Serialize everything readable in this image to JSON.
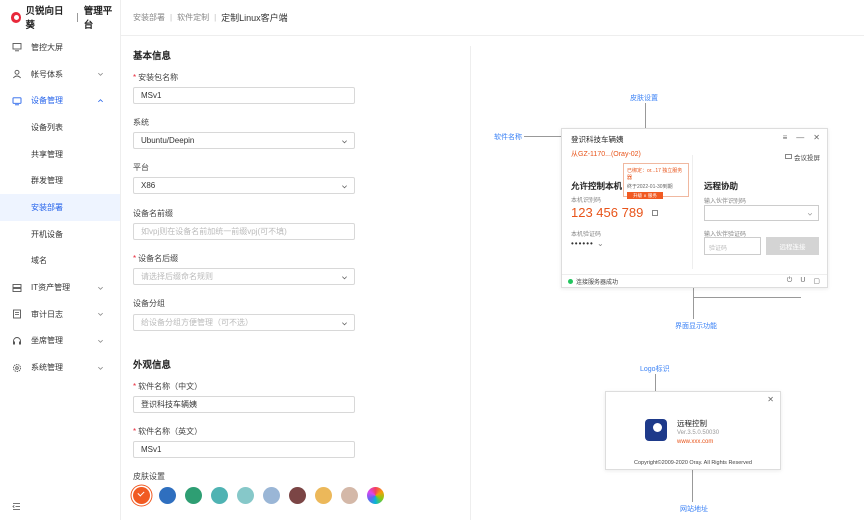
{
  "brand": {
    "name": "贝锐向日葵",
    "platform": "管理平台"
  },
  "sidebar": {
    "items": [
      {
        "label": "管控大屏",
        "icon": "monitor-icon",
        "has_children": false
      },
      {
        "label": "帐号体系",
        "icon": "user-icon",
        "has_children": true
      },
      {
        "label": "设备管理",
        "icon": "device-icon",
        "has_children": true,
        "expanded": true,
        "children": [
          {
            "label": "设备列表"
          },
          {
            "label": "共享管理"
          },
          {
            "label": "群发管理"
          },
          {
            "label": "安装部署",
            "active": true
          },
          {
            "label": "开机设备"
          },
          {
            "label": "域名"
          }
        ]
      },
      {
        "label": "IT资产管理",
        "icon": "server-icon",
        "has_children": true
      },
      {
        "label": "审计日志",
        "icon": "log-icon",
        "has_children": true
      },
      {
        "label": "坐席管理",
        "icon": "headset-icon",
        "has_children": true
      },
      {
        "label": "系统管理",
        "icon": "gear-icon",
        "has_children": true
      }
    ]
  },
  "breadcrumb": [
    "安装部署",
    "软件定制",
    "定制Linux客户端"
  ],
  "form": {
    "basic_title": "基本信息",
    "pkg_name_label": "安装包名称",
    "pkg_name_value": "MSv1",
    "system_label": "系统",
    "system_value": "Ubuntu/Deepin",
    "platform_label": "平台",
    "platform_value": "X86",
    "prefix_label": "设备名前缀",
    "prefix_placeholder": "如vpj则在设备名前加统一前缀vpj(可不填)",
    "suffix_label": "设备名后缀",
    "suffix_placeholder": "请选择后缀命名规则",
    "group_label": "设备分组",
    "group_placeholder": "给设备分组方便管理（可不选）",
    "appearance_title": "外观信息",
    "name_cn_label": "软件名称（中文）",
    "name_cn_value": "登识科技车辆姨",
    "name_en_label": "软件名称（英文）",
    "name_en_value": "MSv1",
    "skin_label": "皮肤设置",
    "skins": [
      "#f15a22",
      "#2f6fbf",
      "#2e9e73",
      "#4fb3b3",
      "#86c8c9",
      "#9ab6d6",
      "#7b4545",
      "#ecb85a",
      "#d4b8a8",
      "rainbow"
    ]
  },
  "preview": {
    "annotations": {
      "skin": "皮肤设置",
      "software_name": "软件名称",
      "display_function": "界面显示功能",
      "logo": "Logo标识",
      "website": "网站地址"
    },
    "window": {
      "title": "登识科技车辆姨",
      "subtitle": "从GZ-1170...(Oray-02)",
      "share_label": "会议投屏",
      "popup_line1": "已绑定：or...17 独立服务器",
      "popup_line2": "终于2022-01-30到期",
      "popup_btn": "升级 ∧ 服务",
      "control_title": "允许控制本机",
      "id_label": "本机识别码",
      "id_value": "123 456 789",
      "code_label": "本机验证码",
      "code_value": "••••••",
      "remote_title": "远程协助",
      "partner_id_label": "输入伙伴识别码",
      "partner_code_label": "输入伙伴验证码",
      "partner_code_placeholder": "验证码",
      "remote_btn": "远程连接",
      "status": "连接服务器成功"
    },
    "about": {
      "name": "远程控制",
      "version": "Ver.3.5.0.50030",
      "url": "www.xxx.com",
      "copyright": "Copyright©2009-2020 Oray. All Rights Reserved"
    }
  }
}
